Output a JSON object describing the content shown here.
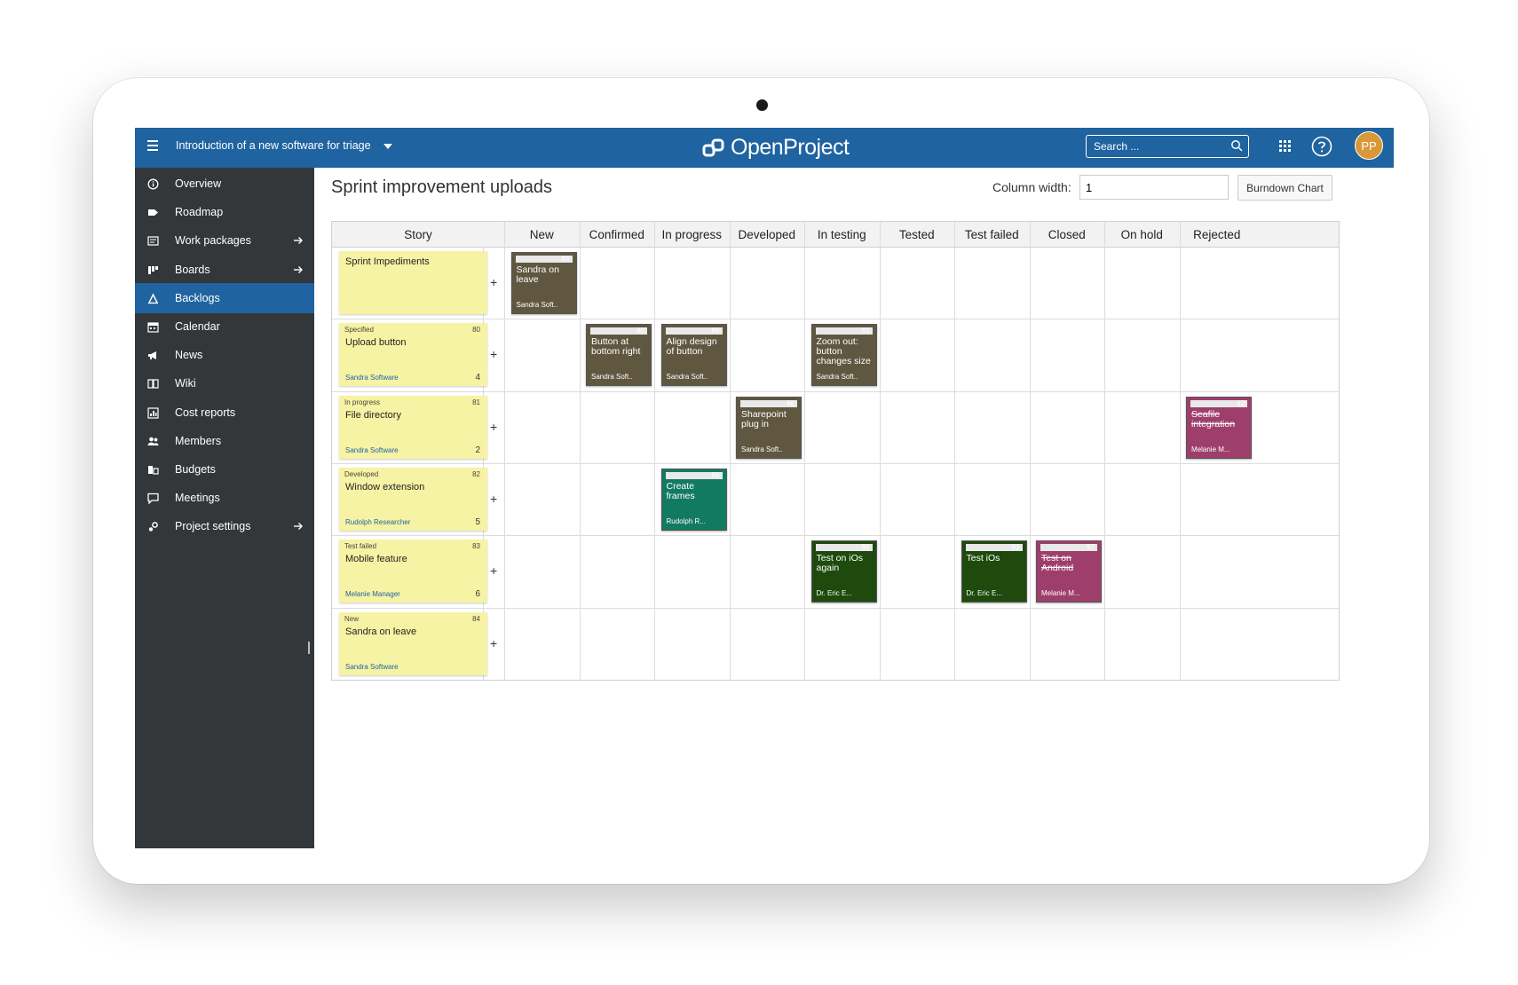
{
  "topbar": {
    "project_title": "Introduction of a new software for triage",
    "logo_text": "OpenProject",
    "search_placeholder": "Search ...",
    "avatar_initials": "PP"
  },
  "sidebar": {
    "items": [
      {
        "label": "Overview",
        "icon": "info-icon",
        "arrow": false,
        "active": false
      },
      {
        "label": "Roadmap",
        "icon": "tag-icon",
        "arrow": false,
        "active": false
      },
      {
        "label": "Work packages",
        "icon": "work-packages-icon",
        "arrow": true,
        "active": false
      },
      {
        "label": "Boards",
        "icon": "boards-icon",
        "arrow": true,
        "active": false
      },
      {
        "label": "Backlogs",
        "icon": "backlogs-icon",
        "arrow": false,
        "active": true
      },
      {
        "label": "Calendar",
        "icon": "calendar-icon",
        "arrow": false,
        "active": false
      },
      {
        "label": "News",
        "icon": "megaphone-icon",
        "arrow": false,
        "active": false
      },
      {
        "label": "Wiki",
        "icon": "book-icon",
        "arrow": false,
        "active": false
      },
      {
        "label": "Cost reports",
        "icon": "cost-reports-icon",
        "arrow": false,
        "active": false
      },
      {
        "label": "Members",
        "icon": "members-icon",
        "arrow": false,
        "active": false
      },
      {
        "label": "Budgets",
        "icon": "budgets-icon",
        "arrow": false,
        "active": false
      },
      {
        "label": "Meetings",
        "icon": "meetings-icon",
        "arrow": false,
        "active": false
      },
      {
        "label": "Project settings",
        "icon": "gears-icon",
        "arrow": true,
        "active": false
      }
    ]
  },
  "main": {
    "title": "Sprint improvement uploads",
    "column_width_label": "Column width:",
    "column_width_value": "1",
    "burndown_label": "Burndown Chart"
  },
  "board": {
    "story_header": "Story",
    "columns": [
      "New",
      "Confirmed",
      "In progress",
      "Developed",
      "In testing",
      "Tested",
      "Test failed",
      "Closed",
      "On hold",
      "Rejected"
    ],
    "add_symbol": "+",
    "rows": [
      {
        "story": {
          "status": "",
          "id": "",
          "title": "Sprint Impediments",
          "owner": "",
          "points": ""
        },
        "tasks": [
          {
            "col": 0,
            "id": "84",
            "title": "Sandra on leave",
            "owner": "Sandra Soft..",
            "color": "#5f5740",
            "closed": false
          }
        ]
      },
      {
        "story": {
          "status": "Specified",
          "id": "80",
          "title": "Upload button",
          "owner": "Sandra Software",
          "points": "4"
        },
        "tasks": [
          {
            "col": 1,
            "id": "90",
            "title": "Button at bottom right",
            "owner": "Sandra Soft..",
            "color": "#5f5740",
            "closed": false
          },
          {
            "col": 2,
            "id": "89",
            "title": "Align design of button",
            "owner": "Sandra Soft..",
            "color": "#5f5740",
            "closed": false
          },
          {
            "col": 4,
            "id": "91",
            "title": "Zoom out: button changes size",
            "owner": "Sandra Soft..",
            "color": "#5f5740",
            "closed": false
          }
        ]
      },
      {
        "story": {
          "status": "In progress",
          "id": "81",
          "title": "File directory",
          "owner": "Sandra Software",
          "points": "2"
        },
        "tasks": [
          {
            "col": 3,
            "id": "88",
            "title": "Sharepoint plug in",
            "owner": "Sandra Soft..",
            "color": "#5f5740",
            "closed": false
          },
          {
            "col": 9,
            "id": "92",
            "title": "Seafile integration",
            "owner": "Melanie M...",
            "color": "#9e3e6a",
            "closed": true
          }
        ]
      },
      {
        "story": {
          "status": "Developed",
          "id": "82",
          "title": "Window extension",
          "owner": "Rudolph Researcher",
          "points": "5"
        },
        "tasks": [
          {
            "col": 2,
            "id": "85",
            "title": "Create frames",
            "owner": "Rudolph R...",
            "color": "#137a62",
            "closed": false
          }
        ]
      },
      {
        "story": {
          "status": "Test failed",
          "id": "83",
          "title": "Mobile feature",
          "owner": "Melanie Manager",
          "points": "6"
        },
        "tasks": [
          {
            "col": 4,
            "id": "86",
            "title": "Test on iOs again",
            "owner": "Dr. Eric E...",
            "color": "#1e4a0e",
            "closed": false
          },
          {
            "col": 6,
            "id": "93",
            "title": "Test iOs",
            "owner": "Dr. Eric E...",
            "color": "#1e4a0e",
            "closed": false
          },
          {
            "col": 7,
            "id": "87",
            "title": "Test on Android",
            "owner": "Melanie M...",
            "color": "#9e3e6a",
            "closed": true
          }
        ]
      },
      {
        "story": {
          "status": "New",
          "id": "84",
          "title": "Sandra on leave",
          "owner": "Sandra Software",
          "points": ""
        },
        "tasks": []
      }
    ]
  },
  "colors": {
    "primary": "#1f63a0",
    "sidebar": "#333739",
    "story_card": "#f7f3a4",
    "avatar": "#d99838"
  }
}
